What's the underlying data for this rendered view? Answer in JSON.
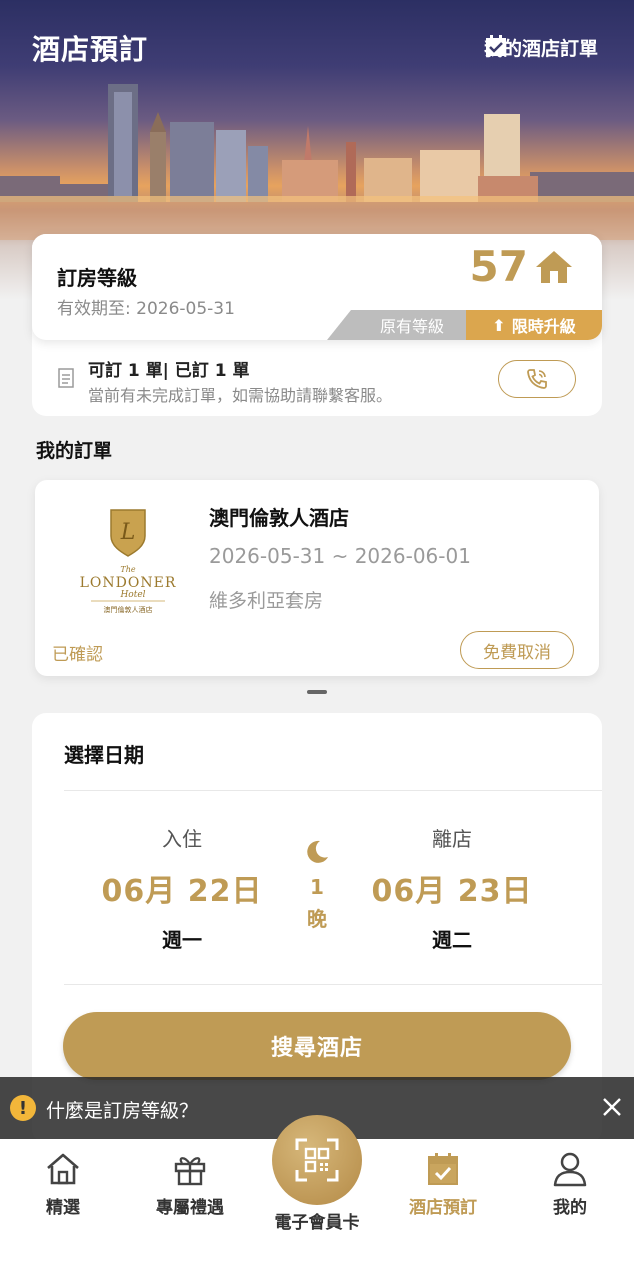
{
  "header": {
    "title": "酒店預訂",
    "my_orders_label": "我的酒店訂單"
  },
  "tier": {
    "title": "訂房等級",
    "valid_until": "有效期至: 2026-05-31",
    "level": "57",
    "tab_original": "原有等級",
    "tab_upgrade": "限時升級",
    "quota_line": "可訂 1 單| 已訂 1 單",
    "quota_note": "當前有未完成訂單，如需協助請聯繫客服。"
  },
  "orders": {
    "section_title": "我的訂單",
    "hotel_name": "澳門倫敦人酒店",
    "dates": "2026-05-31 ~ 2026-06-01",
    "room": "維多利亞套房",
    "status": "已確認",
    "cancel_label": "免費取消",
    "logo": {
      "the": "The",
      "brand": "LONDONER",
      "sub": "Hotel",
      "cn": "澳門倫敦人酒店",
      "monogram": "L"
    }
  },
  "dates": {
    "title": "選擇日期",
    "checkin_label": "入住",
    "checkin_date": "06月 22日",
    "checkin_weekday": "週一",
    "nights_count": "1",
    "nights_unit": "晚",
    "checkout_label": "離店",
    "checkout_date": "06月 23日",
    "checkout_weekday": "週二",
    "search_label": "搜尋酒店"
  },
  "banner": {
    "text": "什麼是訂房等級？"
  },
  "tabbar": {
    "home": "精選",
    "gift": "專屬禮遇",
    "card": "電子會員卡",
    "hotel": "酒店預訂",
    "me": "我的"
  },
  "colors": {
    "gold": "#bf9b55",
    "upgrade": "#dba64e",
    "banner_bg": "#282828"
  }
}
